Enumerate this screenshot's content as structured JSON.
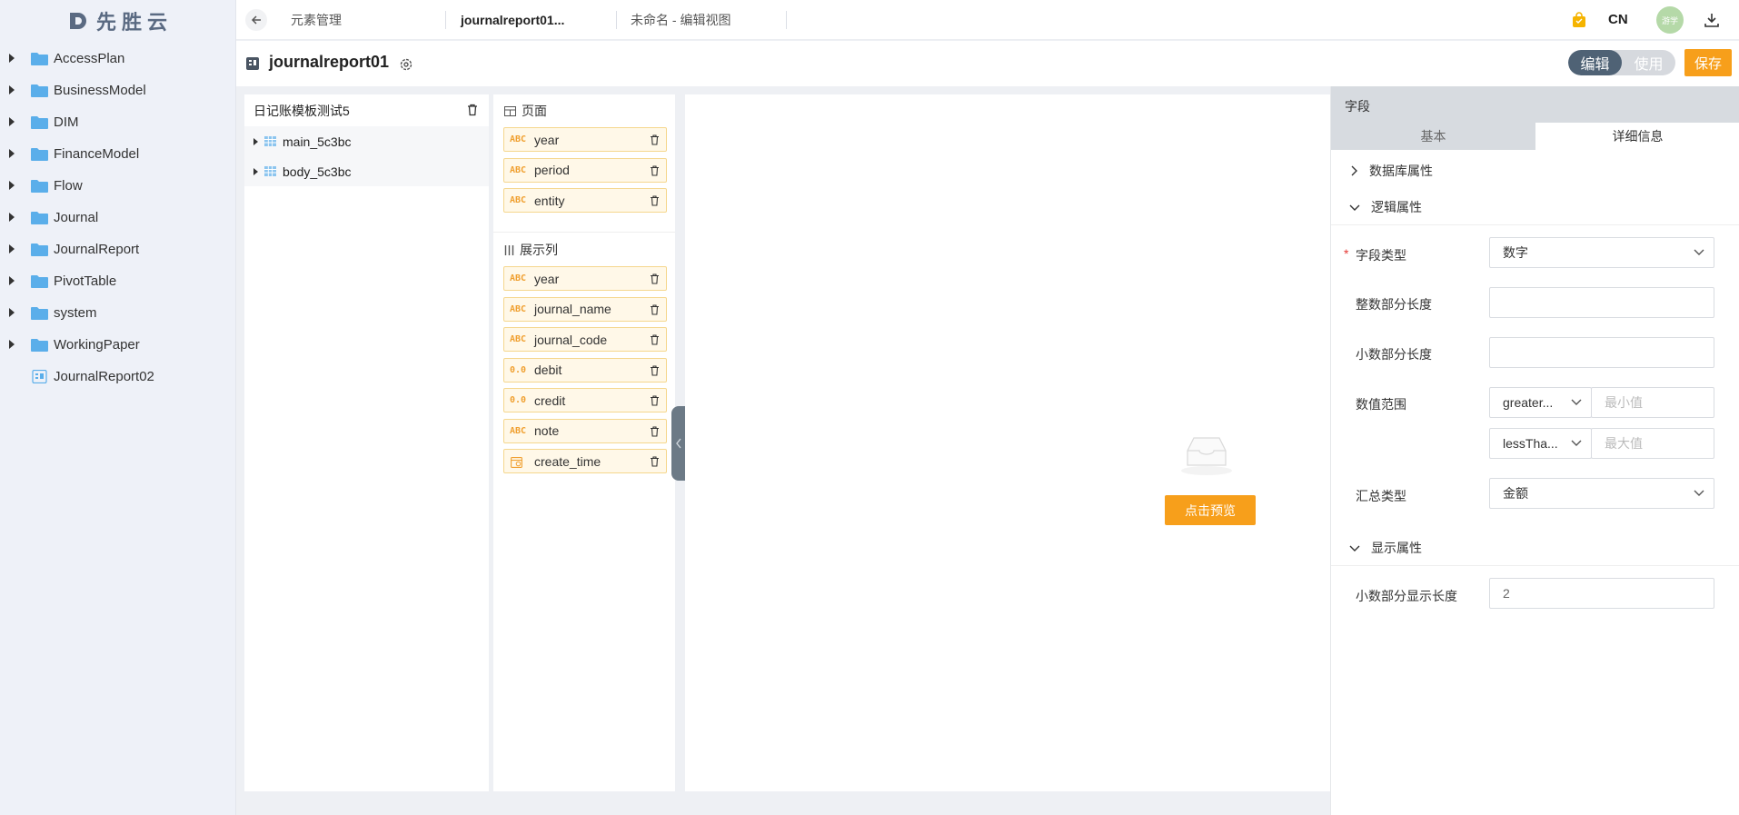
{
  "brand": {
    "name": "先胜云"
  },
  "sidebar": {
    "items": [
      {
        "label": "AccessPlan",
        "type": "folder"
      },
      {
        "label": "BusinessModel",
        "type": "folder"
      },
      {
        "label": "DIM",
        "type": "folder"
      },
      {
        "label": "FinanceModel",
        "type": "folder"
      },
      {
        "label": "Flow",
        "type": "folder"
      },
      {
        "label": "Journal",
        "type": "folder"
      },
      {
        "label": "JournalReport",
        "type": "folder"
      },
      {
        "label": "PivotTable",
        "type": "folder"
      },
      {
        "label": "system",
        "type": "folder"
      },
      {
        "label": "WorkingPaper",
        "type": "folder"
      },
      {
        "label": "JournalReport02",
        "type": "report"
      }
    ]
  },
  "header": {
    "tabs": [
      "元素管理",
      "journalreport01...",
      "未命名 - 编辑视图"
    ],
    "language": "CN",
    "avatar_text": "游学",
    "icons": [
      "back-arrow-icon",
      "shopping-bag-icon",
      "download-icon"
    ]
  },
  "titlebar": {
    "title": "journalreport01",
    "mode_edit": "编辑",
    "mode_use": "使用",
    "save_label": "保存"
  },
  "tree": {
    "title": "日记账模板测试5",
    "rows": [
      "main_5c3bc",
      "body_5c3bc"
    ]
  },
  "fields": {
    "page_section": "页面",
    "page_fields": [
      {
        "type": "ABC",
        "name": "year"
      },
      {
        "type": "ABC",
        "name": "period"
      },
      {
        "type": "ABC",
        "name": "entity"
      }
    ],
    "columns_section": "展示列",
    "column_fields": [
      {
        "type": "ABC",
        "name": "year"
      },
      {
        "type": "ABC",
        "name": "journal_name"
      },
      {
        "type": "ABC",
        "name": "journal_code"
      },
      {
        "type": "0.0",
        "name": "debit"
      },
      {
        "type": "0.0",
        "name": "credit"
      },
      {
        "type": "ABC",
        "name": "note"
      },
      {
        "type": "date",
        "name": "create_time"
      }
    ]
  },
  "canvas": {
    "preview_label": "点击预览"
  },
  "props": {
    "title": "字段",
    "tabs": [
      "基本",
      "详细信息"
    ],
    "active_tab": "详细信息",
    "groups": {
      "db": "数据库属性",
      "logic": "逻辑属性",
      "display": "显示属性"
    },
    "required_mark": "*",
    "field_type_label": "字段类型",
    "field_type_value": "数字",
    "int_len_label": "整数部分长度",
    "dec_len_label": "小数部分长度",
    "range_label": "数值范围",
    "range_min_op": "greater...",
    "range_min_placeholder": "最小值",
    "range_max_op": "lessTha...",
    "range_max_placeholder": "最大值",
    "agg_label": "汇总类型",
    "agg_value": "金额",
    "dec_display_label": "小数部分显示长度",
    "dec_display_value": "2"
  },
  "colors": {
    "accent": "#f79f1b",
    "folder": "#5aaeea",
    "toggle_active": "#4f6275"
  }
}
